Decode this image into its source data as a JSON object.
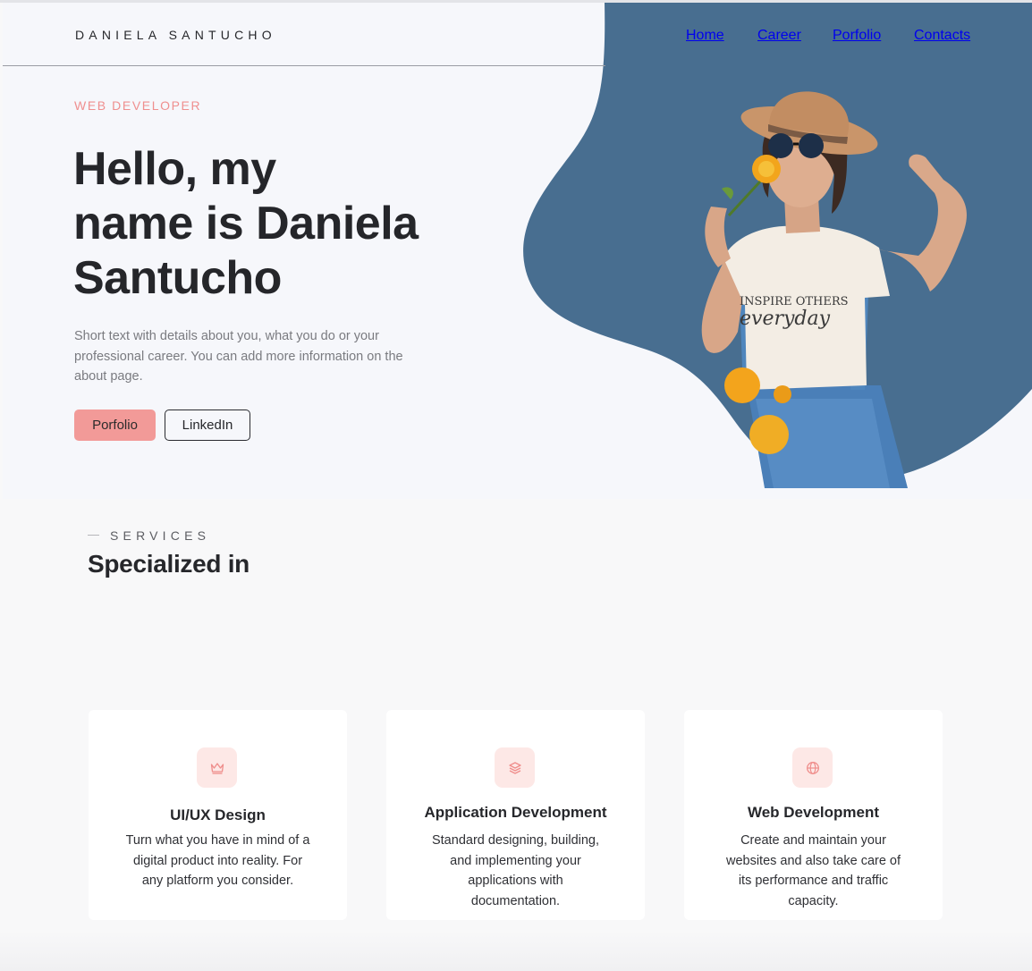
{
  "header": {
    "logo": "DANIELA SANTUCHO",
    "nav": [
      {
        "label": "Home"
      },
      {
        "label": "Career"
      },
      {
        "label": "Porfolio"
      },
      {
        "label": "Contacts"
      }
    ]
  },
  "hero": {
    "eyebrow": "WEB DEVELOPER",
    "title_line1": "Hello,  my",
    "title_line2": "name is Daniela",
    "title_line3": "Santucho",
    "description": "Short text with details about you, what you do or your professional career. You can add more information on the about page.",
    "primary_button": "Porfolio",
    "secondary_button": "LinkedIn",
    "shirt_text_1": "INSPIRE OTHERS",
    "shirt_text_2": "everyday"
  },
  "services": {
    "eyebrow": "SERVICES",
    "title": "Specialized in",
    "cards": [
      {
        "icon": "crown-icon",
        "title": "UI/UX Design",
        "text": "Turn what you have in mind of a digital product into reality. For any platform you consider."
      },
      {
        "icon": "layers-icon",
        "title": "Application Development",
        "text": "Standard designing, building, and implementing your applications with documentation."
      },
      {
        "icon": "globe-icon",
        "title": "Web Development",
        "text": "Create and maintain your websites and also take care of its performance and traffic capacity."
      }
    ]
  },
  "colors": {
    "accent": "#f29a98",
    "brand_blue": "#4a6f90",
    "text_dark": "#26272b"
  }
}
